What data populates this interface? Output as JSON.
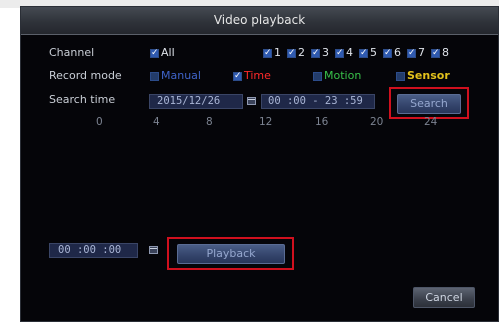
{
  "window": {
    "title": "Video playback"
  },
  "channel": {
    "label": "Channel",
    "all_label": "All",
    "channels": [
      "1",
      "2",
      "3",
      "4",
      "5",
      "6",
      "7",
      "8"
    ]
  },
  "record_mode": {
    "label": "Record mode",
    "manual": "Manual",
    "time": "Time",
    "motion": "Motion",
    "sensor": "Sensor"
  },
  "search_time": {
    "label": "Search time",
    "date": "2015/12/26",
    "time_range": "00 :00  -  23 :59",
    "search_button": "Search"
  },
  "timeline": {
    "ticks": [
      "0",
      "4",
      "8",
      "12",
      "16",
      "20",
      "24"
    ]
  },
  "playback": {
    "time": "00 :00 :00",
    "button": "Playback"
  },
  "cancel_button": "Cancel",
  "colors": {
    "manual": "#3f63c8",
    "time": "#ff2a2a",
    "motion": "#38c24a",
    "sensor": "#e3c21c",
    "highlight": "#d0101e"
  }
}
